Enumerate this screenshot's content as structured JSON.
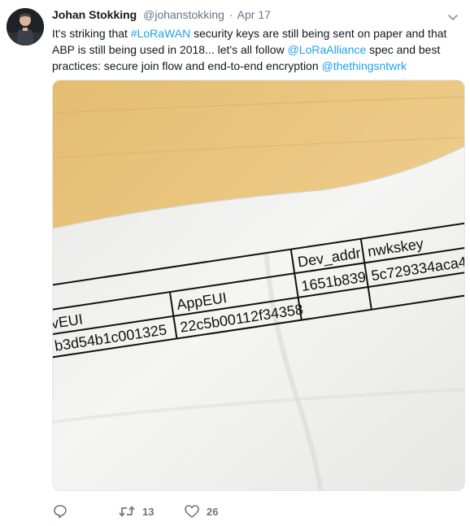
{
  "tweet": {
    "author_name": "Johan Stokking",
    "handle": "@johanstokking",
    "separator": "·",
    "date": "Apr 17",
    "text_segments": [
      {
        "text": "It's striking that ",
        "type": "plain"
      },
      {
        "text": "#LoRaWAN",
        "type": "link"
      },
      {
        "text": " security keys are still being sent on paper and that ABP is still being used in 2018... let's all follow ",
        "type": "plain"
      },
      {
        "text": "@LoRaAlliance",
        "type": "link"
      },
      {
        "text": " spec and best practices: secure join flow and end-to-end encryption ",
        "type": "plain"
      },
      {
        "text": "@thethingsntwrk",
        "type": "link"
      }
    ]
  },
  "photo_table": {
    "headers": [
      "vEUI",
      "AppEUI",
      "Dev_addr",
      "nwkskey"
    ],
    "values": [
      "b3d54b1c001325",
      "22c5b00112f34358",
      "1651b839",
      "5c729334aca4"
    ]
  },
  "actions": {
    "reply_icon": "reply-icon",
    "retweet_icon": "retweet-icon",
    "retweet_count": "13",
    "like_icon": "heart-icon",
    "like_count": "26"
  },
  "colors": {
    "link": "#1da1f2",
    "muted": "#657786",
    "wood": "#e9c57f",
    "paper": "#f1f1ef"
  }
}
